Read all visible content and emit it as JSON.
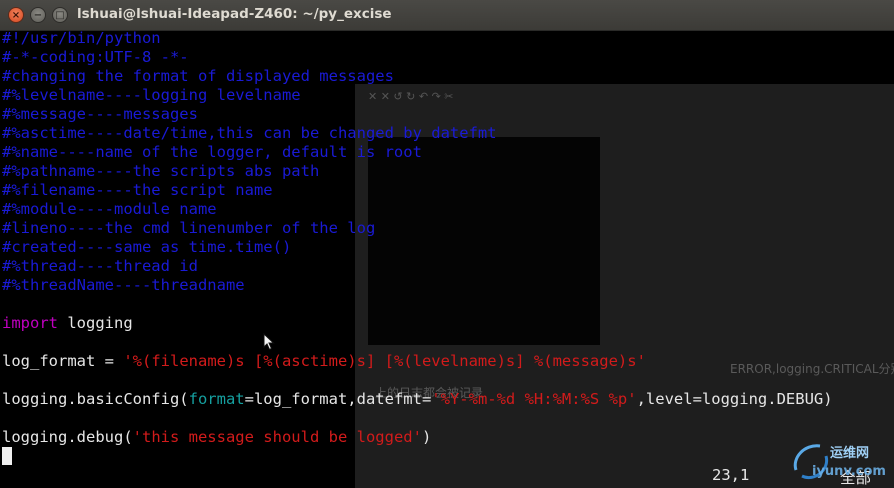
{
  "window": {
    "title": "lshuai@lshuai-Ideapad-Z460: ~/py_excise",
    "buttons": {
      "close": "×",
      "minimize": "−",
      "maximize": "□"
    }
  },
  "editor": {
    "lines": [
      [
        {
          "c": "cm",
          "t": "#!/usr/bin/python"
        }
      ],
      [
        {
          "c": "cm",
          "t": "#-*-coding:UTF-8 -*-"
        }
      ],
      [
        {
          "c": "cm",
          "t": "#changing the format of displayed messages"
        }
      ],
      [
        {
          "c": "cm",
          "t": "#%levelname----logging levelname"
        }
      ],
      [
        {
          "c": "cm",
          "t": "#%message----messages"
        }
      ],
      [
        {
          "c": "cm",
          "t": "#%asctime----date/time,this can be changed by datefmt"
        }
      ],
      [
        {
          "c": "cm",
          "t": "#%name----name of the logger, default is root"
        }
      ],
      [
        {
          "c": "cm",
          "t": "#%pathname----the scripts abs path"
        }
      ],
      [
        {
          "c": "cm",
          "t": "#%filename----the script name"
        }
      ],
      [
        {
          "c": "cm",
          "t": "#%module----module name"
        }
      ],
      [
        {
          "c": "cm",
          "t": "#lineno----the cmd linenumber of the log"
        }
      ],
      [
        {
          "c": "cm",
          "t": "#created----same as time.time()"
        }
      ],
      [
        {
          "c": "cm",
          "t": "#%thread----thread id"
        }
      ],
      [
        {
          "c": "cm",
          "t": "#%threadName----threadname"
        }
      ],
      [
        {
          "c": "tx",
          "t": ""
        }
      ],
      [
        {
          "c": "kw",
          "t": "import"
        },
        {
          "c": "tx",
          "t": " logging"
        }
      ],
      [
        {
          "c": "tx",
          "t": ""
        }
      ],
      [
        {
          "c": "tx",
          "t": "log_format = "
        },
        {
          "c": "st",
          "t": "'%(filename)s [%(asctime)s] [%(levelname)s] %(message)s'"
        }
      ],
      [
        {
          "c": "tx",
          "t": ""
        }
      ],
      [
        {
          "c": "tx",
          "t": "logging.basicConfig("
        },
        {
          "c": "param",
          "t": "format"
        },
        {
          "c": "tx",
          "t": "=log_format,datefmt="
        },
        {
          "c": "st",
          "t": "'%Y-%m-%d %H:%M:%S %p'"
        },
        {
          "c": "tx",
          "t": ",level=logging.DEBUG)"
        }
      ],
      [
        {
          "c": "tx",
          "t": ""
        }
      ],
      [
        {
          "c": "tx",
          "t": "logging.debug("
        },
        {
          "c": "st",
          "t": "'this message should be logged'"
        },
        {
          "c": "tx",
          "t": ")"
        }
      ]
    ],
    "cursor_line": 23,
    "ruler": "23,1",
    "position": "全部"
  },
  "background_ghost_text": {
    "line1": "ERROR,logging.CRITICAL分别",
    "line2": "上的日志都会被记录"
  },
  "watermark": {
    "text_top": "运维网",
    "text_bottom": "iyunv.com"
  },
  "colors": {
    "comment": "#1a1ad6",
    "keyword": "#c000c0",
    "string": "#d21b1b",
    "text": "#e6e6e6",
    "param": "#15a0a0",
    "titlebar": "#3c3b37",
    "close_button": "#e0592f"
  }
}
